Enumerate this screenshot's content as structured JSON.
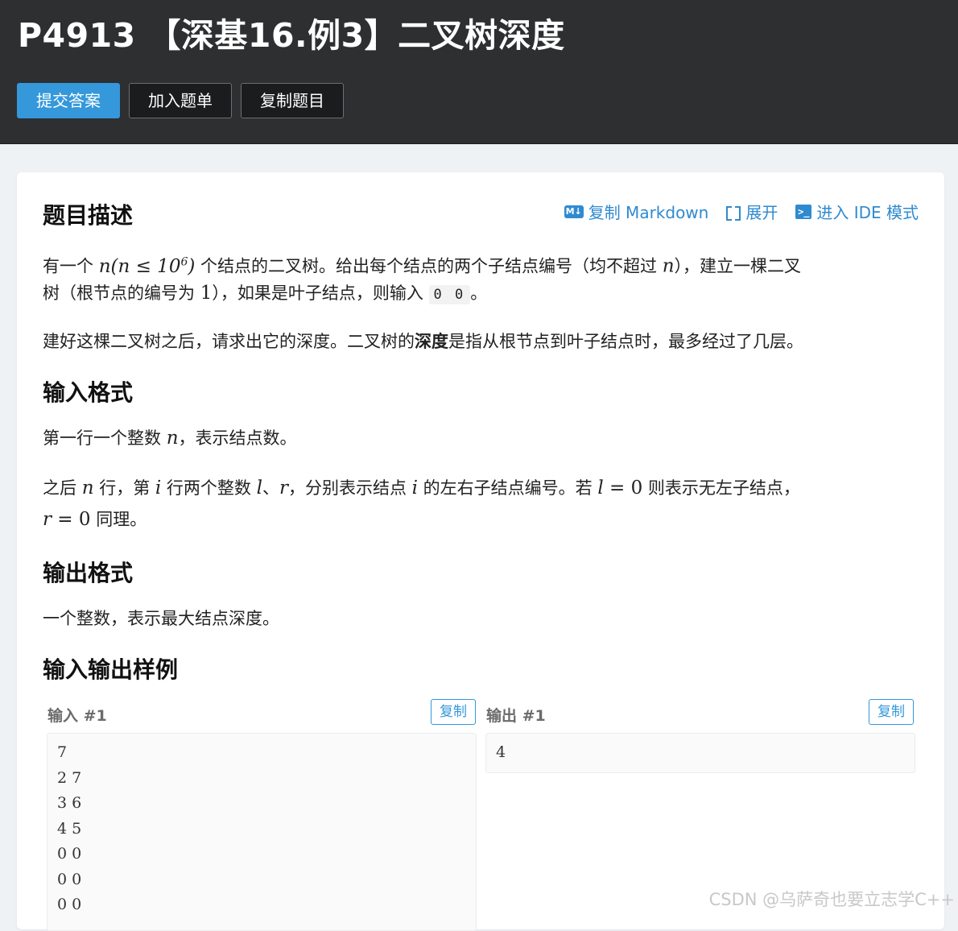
{
  "header": {
    "title": "P4913 【深基16.例3】二叉树深度",
    "buttons": {
      "submit": "提交答案",
      "add_list": "加入题单",
      "copy_problem": "复制题目"
    }
  },
  "actions": {
    "copy_markdown": "复制 Markdown",
    "expand": "展开",
    "ide_mode": "进入 IDE 模式",
    "md_icon_text": "M↓",
    "ide_icon_text": ">_"
  },
  "sections": {
    "description_title": "题目描述",
    "input_title": "输入格式",
    "output_title": "输出格式",
    "samples_title": "输入输出样例"
  },
  "description": {
    "line1_a": "有一个 ",
    "line1_math": "n(n ≤ 10",
    "line1_sup": "6",
    "line1_math_close": ")",
    "line1_b": " 个结点的二叉树。给出每个结点的两个子结点编号（均不超过 ",
    "line1_n": "n",
    "line1_c": "），建立一棵二叉",
    "line2_a": "树（根节点的编号为 ",
    "line2_one": "1",
    "line2_b": "），如果是叶子结点，则输入 ",
    "line2_code": "0 0",
    "line2_c": "。",
    "para2_a": "建好这棵二叉树之后，请求出它的深度。二叉树的",
    "para2_bold": "深度",
    "para2_b": "是指从根节点到叶子结点时，最多经过了几层。"
  },
  "input_format": {
    "p1_a": "第一行一个整数 ",
    "p1_n": "n",
    "p1_b": "，表示结点数。",
    "p2_a": "之后 ",
    "p2_n": "n",
    "p2_b": " 行，第 ",
    "p2_i": "i",
    "p2_c": " 行两个整数 ",
    "p2_l": "l",
    "p2_d": "、",
    "p2_r": "r",
    "p2_e": "，分别表示结点 ",
    "p2_i2": "i",
    "p2_f": " 的左右子结点编号。若 ",
    "p2_l2": "l",
    "p2_eq": " = 0",
    "p2_g": " 则表示无左子结点，",
    "p3_r": "r",
    "p3_eq": " = 0",
    "p3_a": " 同理。"
  },
  "output_format": {
    "text": "一个整数，表示最大结点深度。"
  },
  "samples": {
    "input_label": "输入 #1",
    "output_label": "输出 #1",
    "copy_label": "复制",
    "input_lines": [
      "7",
      "2 7",
      "3 6",
      "4 5",
      "0 0",
      "0 0",
      "0 0"
    ],
    "output_lines": [
      "4"
    ]
  },
  "watermark": "CSDN @乌萨奇也要立志学C++"
}
